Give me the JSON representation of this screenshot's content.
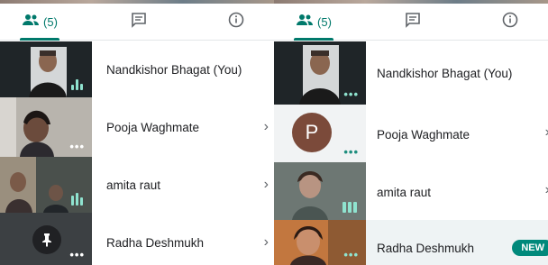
{
  "left": {
    "people_count": "(5)",
    "participants": [
      {
        "name": "Nandkishor Bhagat (You)"
      },
      {
        "name": "Pooja Waghmate"
      },
      {
        "name": "amita raut"
      },
      {
        "name": "Radha Deshmukh"
      }
    ]
  },
  "right": {
    "people_count": "(5)",
    "participants": [
      {
        "name": "Nandkishor Bhagat (You)"
      },
      {
        "name": "Pooja Waghmate",
        "avatar_letter": "P"
      },
      {
        "name": "amita raut"
      },
      {
        "name": "Radha Deshmukh",
        "badge": "NEW"
      }
    ]
  },
  "icons": {
    "people": "people-icon",
    "chat": "chat-icon",
    "info": "info-icon",
    "chevron": "chevron-right-icon",
    "pin": "pin-icon",
    "more": "more-dots-icon",
    "audio": "audio-level-icon"
  },
  "colors": {
    "accent": "#00796b",
    "avatar_p": "#7b4a3a",
    "badge": "#00897b"
  }
}
